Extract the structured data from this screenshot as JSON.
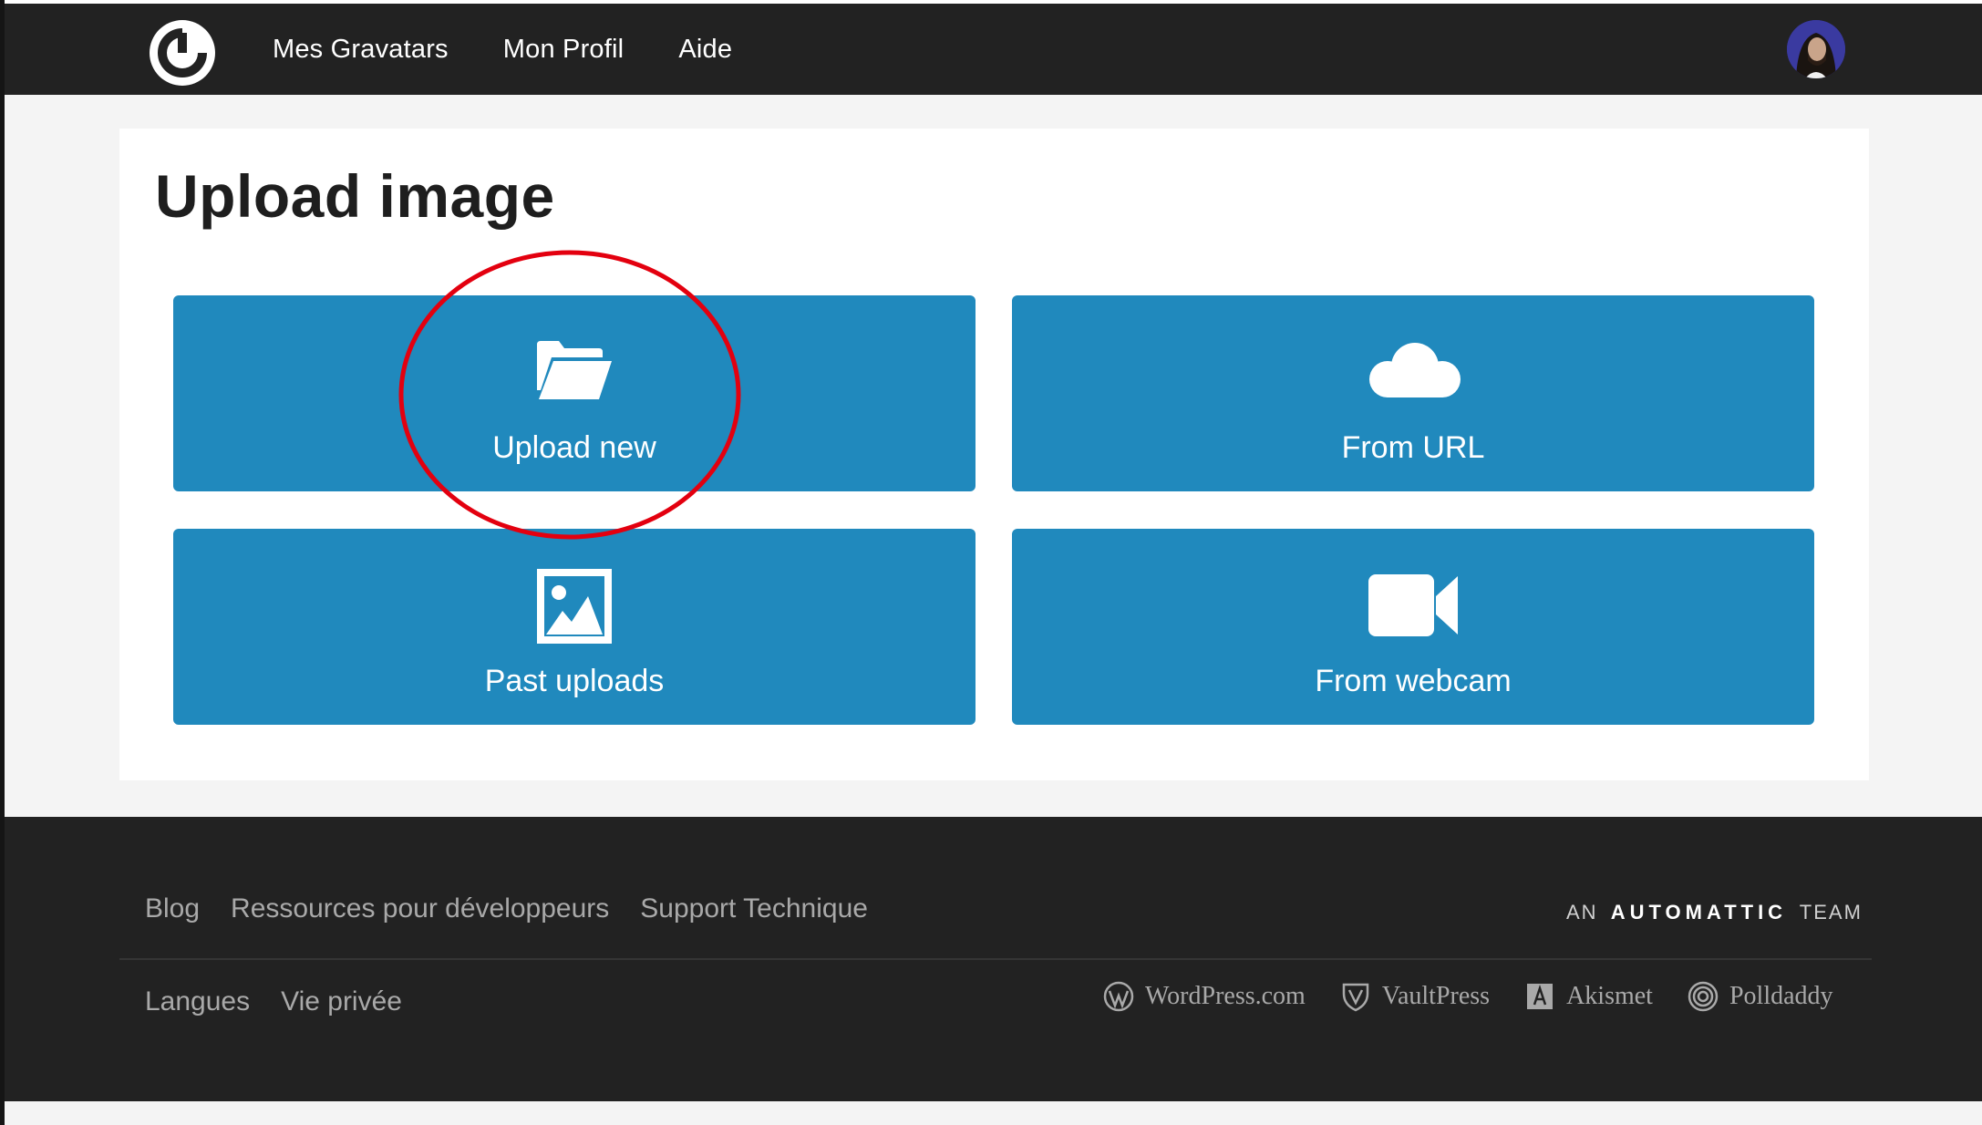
{
  "header": {
    "nav": [
      "Mes Gravatars",
      "Mon Profil",
      "Aide"
    ]
  },
  "main": {
    "title": "Upload image",
    "options": {
      "upload_new": "Upload new",
      "from_url": "From URL",
      "past_uploads": "Past uploads",
      "from_webcam": "From webcam"
    }
  },
  "footer": {
    "links_row1": [
      "Blog",
      "Ressources pour développeurs",
      "Support Technique"
    ],
    "links_row2": [
      "Langues",
      "Vie privée"
    ],
    "automattic": {
      "prefix": "AN",
      "brand": "AUTOMATTIC",
      "suffix": "TEAM"
    },
    "family": [
      "WordPress.com",
      "VaultPress",
      "Akismet",
      "Polldaddy"
    ]
  },
  "colors": {
    "header_bg": "#222222",
    "accent": "#2089bd",
    "annotation": "#e3000f"
  },
  "icons": {
    "logo": "gravatar-logo-icon",
    "upload_new": "folder-open-icon",
    "from_url": "cloud-icon",
    "past_uploads": "image-icon",
    "from_webcam": "video-camera-icon"
  }
}
